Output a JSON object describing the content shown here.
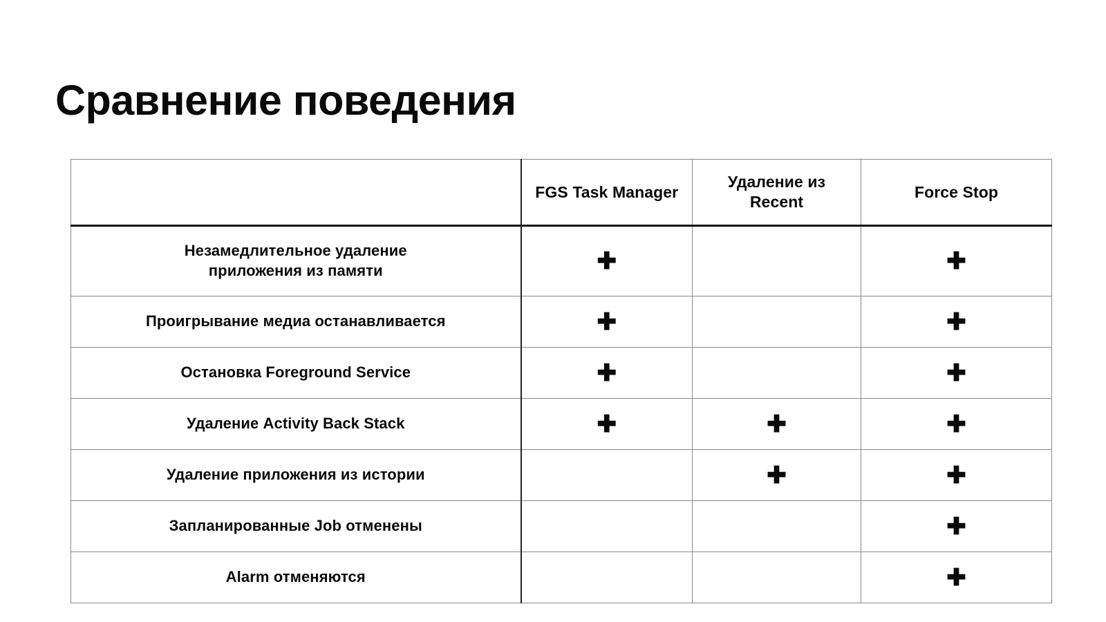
{
  "slide": {
    "title": "Сравнение поведения",
    "background_color": "#ffffff",
    "text_color": "#0a0a0a",
    "grid_color": "#888888",
    "header_rule_color": "#111111"
  },
  "table": {
    "columns": [
      {
        "key": "label",
        "label": ""
      },
      {
        "key": "fgs",
        "label": "FGS Task Manager"
      },
      {
        "key": "recent",
        "label": "Удаление из Recent"
      },
      {
        "key": "force",
        "label": "Force Stop"
      }
    ],
    "mark_symbol": "✚",
    "rows": [
      {
        "label": "Незамедлительное удаление приложения из памяти",
        "label_line1": "Незамедлительное удаление",
        "label_line2": "приложения из памяти",
        "fgs": "✚",
        "recent": "",
        "force": "✚"
      },
      {
        "label": "Проигрывание медиа останавливается",
        "label_line1": "Проигрывание медиа останавливается",
        "label_line2": "",
        "fgs": "✚",
        "recent": "",
        "force": "✚"
      },
      {
        "label": "Остановка Foreground Service",
        "label_line1": "Остановка Foreground Service",
        "label_line2": "",
        "fgs": "✚",
        "recent": "",
        "force": "✚"
      },
      {
        "label": "Удаление Activity Back Stack",
        "label_line1": "Удаление Activity Back Stack",
        "label_line2": "",
        "fgs": "✚",
        "recent": "✚",
        "force": "✚"
      },
      {
        "label": "Удаление приложения из истории",
        "label_line1": "Удаление приложения из истории",
        "label_line2": "",
        "fgs": "",
        "recent": "✚",
        "force": "✚"
      },
      {
        "label": "Запланированные Job отменены",
        "label_line1": "Запланированные Job отменены",
        "label_line2": "",
        "fgs": "",
        "recent": "",
        "force": "✚"
      },
      {
        "label": "Alarm отменяются",
        "label_line1": "Alarm отменяются",
        "label_line2": "",
        "fgs": "",
        "recent": "",
        "force": "✚"
      }
    ]
  }
}
